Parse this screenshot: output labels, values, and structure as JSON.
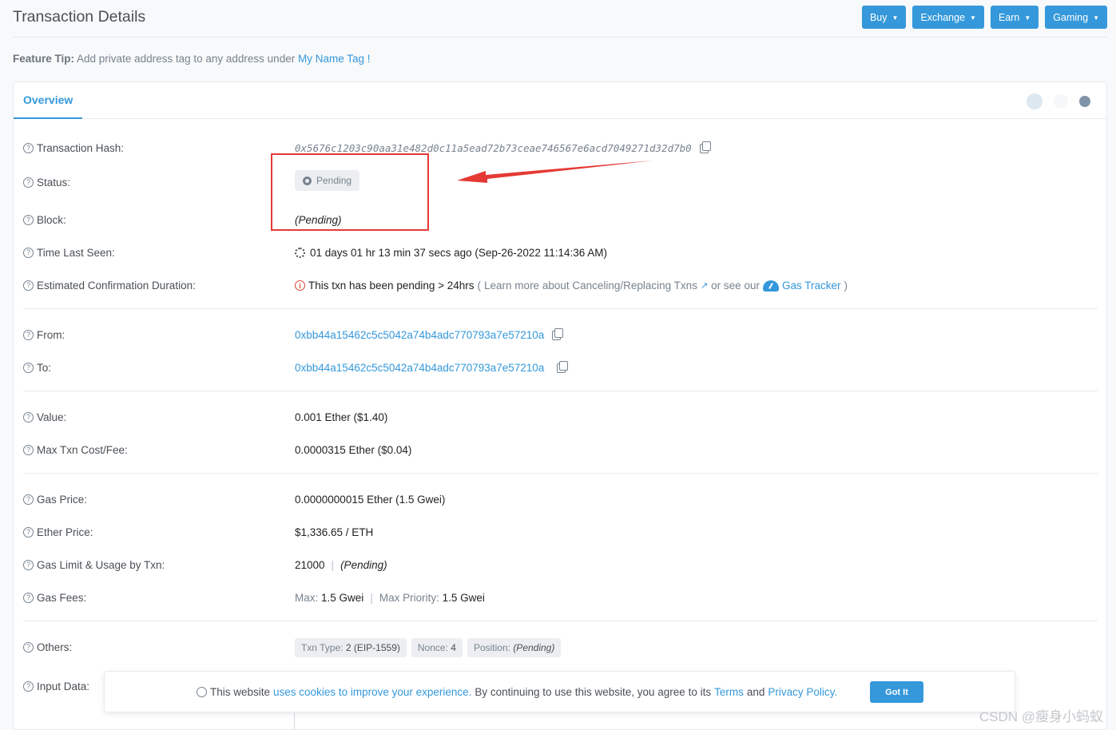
{
  "header": {
    "title": "Transaction Details",
    "buttons": [
      "Buy",
      "Exchange",
      "Earn",
      "Gaming"
    ]
  },
  "feature_tip": {
    "label": "Feature Tip:",
    "text": "Add private address tag to any address under",
    "link": "My Name Tag",
    "suffix": "!"
  },
  "tabs": {
    "overview": "Overview"
  },
  "rows": {
    "hash": {
      "label": "Transaction Hash:",
      "value": "0x5676c1203c90aa31e482d0c11a5ead72b73ceae746567e6acd7049271d32d7b0"
    },
    "status": {
      "label": "Status:",
      "value": "Pending"
    },
    "block": {
      "label": "Block:",
      "value": "(Pending)"
    },
    "time_last_seen": {
      "label": "Time Last Seen:",
      "value": "01 days 01 hr 13 min 37 secs ago (Sep-26-2022 11:14:36 AM)"
    },
    "est_confirm": {
      "label": "Estimated Confirmation Duration:",
      "text": "This txn has been pending > 24hrs",
      "open_paren": "(",
      "learn_link": "Learn more about Canceling/Replacing Txns",
      "or_see": "or see our",
      "gas_link": "Gas Tracker",
      "close_paren": ")"
    },
    "from": {
      "label": "From:",
      "value": "0xbb44a15462c5c5042a74b4adc770793a7e57210a"
    },
    "to": {
      "label": "To:",
      "value": "0xbb44a15462c5c5042a74b4adc770793a7e57210a"
    },
    "value": {
      "label": "Value:",
      "value": "0.001 Ether ($1.40)"
    },
    "max_fee": {
      "label": "Max Txn Cost/Fee:",
      "value": "0.0000315 Ether ($0.04)"
    },
    "gas_price": {
      "label": "Gas Price:",
      "value": "0.0000000015 Ether (1.5 Gwei)"
    },
    "ether_price": {
      "label": "Ether Price:",
      "value": "$1,336.65 / ETH"
    },
    "gas_limit": {
      "label": "Gas Limit & Usage by Txn:",
      "limit": "21000",
      "sep": "|",
      "usage": "(Pending)"
    },
    "gas_fees": {
      "label": "Gas Fees:",
      "max_label": "Max:",
      "max_value": "1.5 Gwei",
      "sep": "|",
      "prio_label": "Max Priority:",
      "prio_value": "1.5 Gwei"
    },
    "others": {
      "label": "Others:",
      "txn_type_label": "Txn Type:",
      "txn_type_value": "2 (EIP-1559)",
      "nonce_label": "Nonce:",
      "nonce_value": "4",
      "position_label": "Position:",
      "position_value": "(Pending)"
    },
    "input_data": {
      "label": "Input Data:"
    }
  },
  "cookie": {
    "t1": "This website",
    "link1": "uses cookies to improve your experience.",
    "t2": "By continuing to use this website, you agree to its",
    "terms": "Terms",
    "and": "and",
    "privacy": "Privacy Policy.",
    "button": "Got It"
  },
  "watermark": "CSDN @瘦身小蚂蚁",
  "colors": {
    "accent": "#3498db",
    "annotation": "#e53935"
  }
}
